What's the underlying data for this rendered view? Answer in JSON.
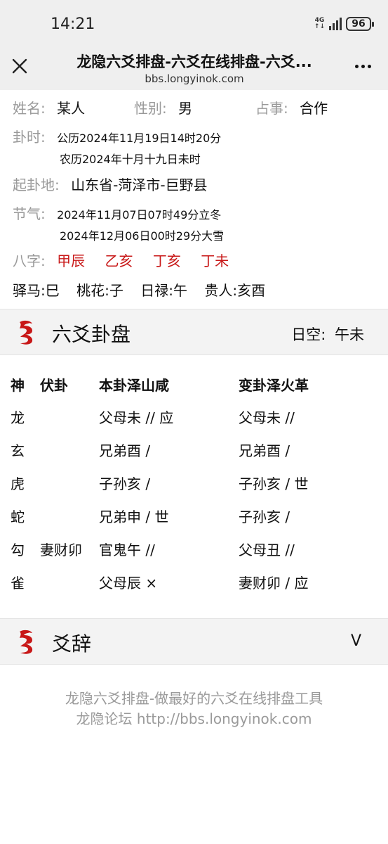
{
  "status": {
    "time": "14:21",
    "network_top": "4G",
    "network_bottom": "↑↓",
    "battery": "96"
  },
  "header": {
    "title": "龙隐六爻排盘-六爻在线排盘-六爻...",
    "url": "bbs.longyinok.com"
  },
  "info": {
    "name_label": "姓名:",
    "name": "某人",
    "gender_label": "性别:",
    "gender": "男",
    "topic_label": "占事:",
    "topic": "合作",
    "time_label": "卦时:",
    "solar": "公历2024年11月19日14时20分",
    "lunar": "农历2024年十月十九日未时",
    "place_label": "起卦地:",
    "place": "山东省-菏泽市-巨野县",
    "solar_term_label": "节气:",
    "term1": "2024年11月07日07时49分立冬",
    "term2": "2024年12月06日00时29分大雪",
    "bazi_label": "八字:",
    "bazi": [
      "甲辰",
      "乙亥",
      "丁亥",
      "丁未"
    ],
    "shensha": [
      "驿马:巳",
      "桃花:子",
      "日禄:午",
      "贵人:亥酉"
    ]
  },
  "gua_section": {
    "title": "六爻卦盘",
    "void_label": "日空:",
    "void_value": "午未"
  },
  "table": {
    "headers": [
      "神",
      "伏卦",
      "本卦泽山咸",
      "变卦泽火革"
    ],
    "rows": [
      {
        "god": "龙",
        "hidden": "",
        "main": "父母未 // 应",
        "changed": "父母未 //"
      },
      {
        "god": "玄",
        "hidden": "",
        "main": "兄弟酉  /",
        "changed": "兄弟酉  /"
      },
      {
        "god": "虎",
        "hidden": "",
        "main": "子孙亥  /",
        "changed": "子孙亥  /  世"
      },
      {
        "god": "蛇",
        "hidden": "",
        "main": "兄弟申  /  世",
        "changed": "子孙亥  /"
      },
      {
        "god": "勾",
        "hidden": "妻财卯",
        "main": "官鬼午 //",
        "changed": "父母丑 //"
      },
      {
        "god": "雀",
        "hidden": "",
        "main": "父母辰 ×",
        "changed": "妻财卯  /  应"
      }
    ]
  },
  "yaoci_section": {
    "title": "爻辞",
    "toggle": "V"
  },
  "footer": {
    "line1": "龙隐六爻排盘-做最好的六爻在线排盘工具",
    "line2": "龙隐论坛 http://bbs.longyinok.com"
  },
  "colors": {
    "accent_red": "#c81818",
    "label_grey": "#999999",
    "header_bg": "#efefef"
  },
  "icons": {
    "close": "close-icon",
    "more": "more-icon",
    "logo": "dragon-logo-icon"
  }
}
